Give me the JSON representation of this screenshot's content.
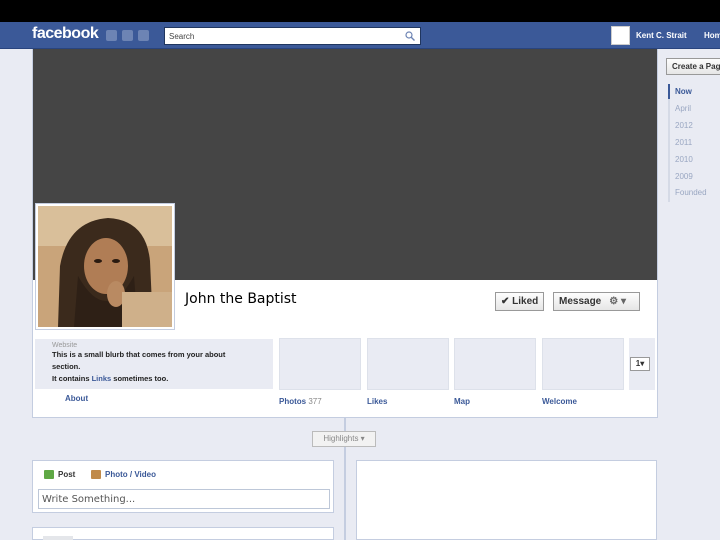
{
  "topbar": {
    "logo": "facebook",
    "search_placeholder": "Search",
    "user_name": "Kent C. Strait",
    "home_label": "Home"
  },
  "profile": {
    "name": "John the Baptist",
    "liked_label": "✔ Liked",
    "message_label": "Message",
    "gear_label": "⚙ ▾"
  },
  "about": {
    "label": "Website",
    "line1": "This is a small blurb that comes from your about",
    "line2": "section.",
    "line3_pre": "It contains ",
    "line3_link": "Links",
    "line3_post": " sometimes too.",
    "link_label": "About"
  },
  "tiles": [
    {
      "label": "Photos",
      "count": "377"
    },
    {
      "label": "Likes",
      "count": ""
    },
    {
      "label": "Map",
      "count": ""
    },
    {
      "label": "Welcome",
      "count": ""
    }
  ],
  "more_button": "1▾",
  "timeline": {
    "highlights": "Highlights ▾"
  },
  "composer": {
    "post_tab": "Post",
    "photo_tab": "Photo / Video",
    "placeholder": "Write Something..."
  },
  "right_rail": {
    "create_page": "Create a Page",
    "scrubber": [
      "Now",
      "April",
      "2012",
      "2011",
      "2010",
      "2009",
      "Founded"
    ]
  },
  "colors": {
    "brand": "#3b5998",
    "cover": "#454545"
  }
}
